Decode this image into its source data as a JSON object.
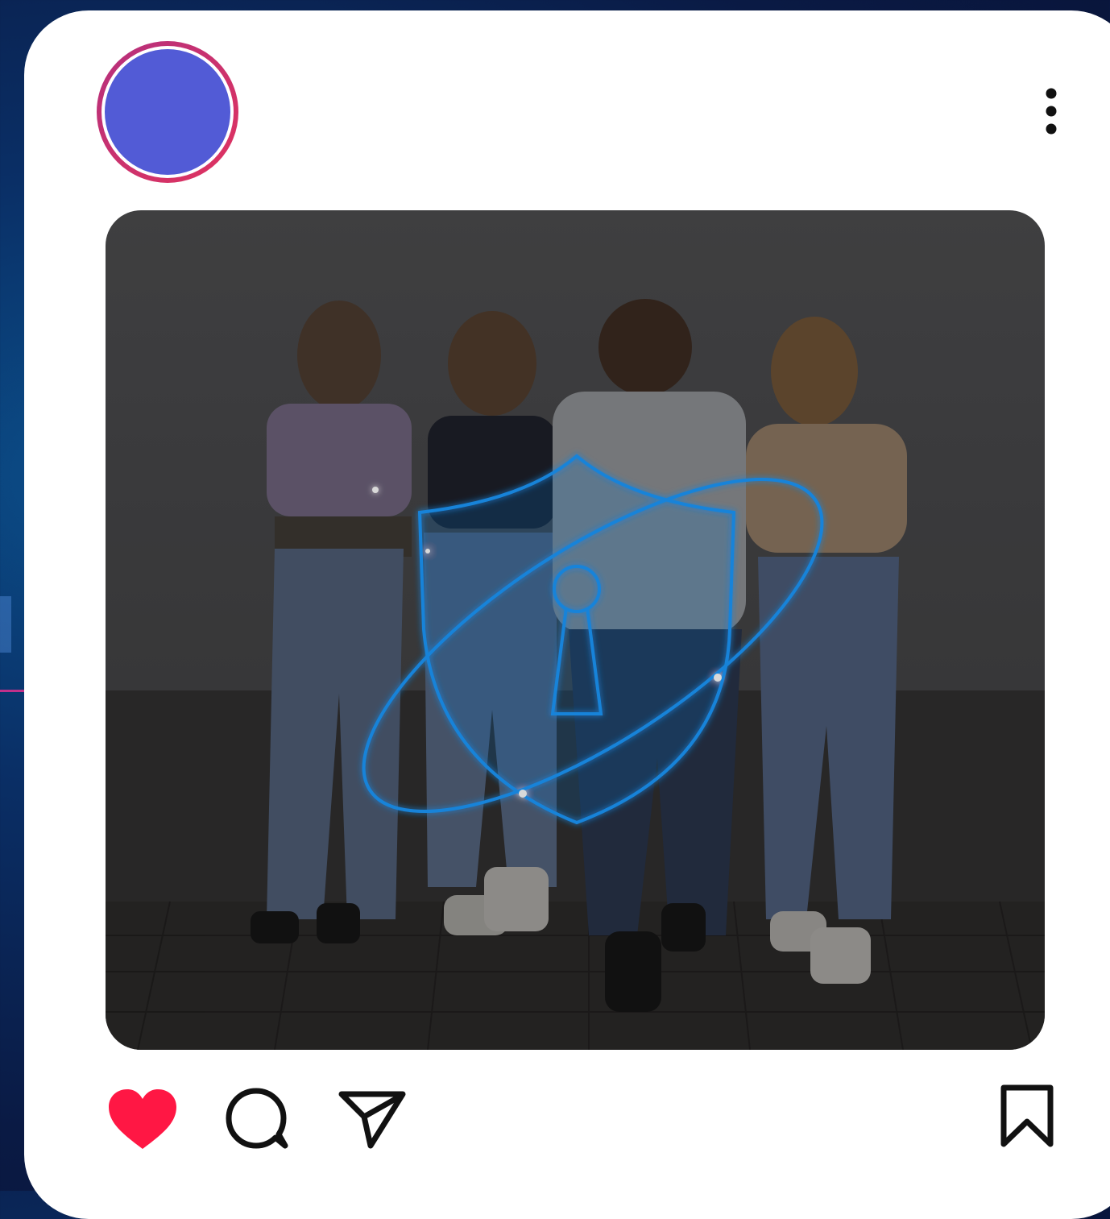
{
  "post": {
    "avatar": {
      "ring_gradient": [
        "#b5307d",
        "#e0335f"
      ],
      "fill_color": "#525bd6"
    },
    "menu_icon": "more-vertical-icon",
    "image": {
      "description_icon": "security-shield-keyhole-icon",
      "accent_color": "#1e9bff"
    },
    "actions": {
      "like_icon": "heart-icon",
      "like_color": "#ff1744",
      "liked": true,
      "comment_icon": "comment-icon",
      "share_icon": "send-icon",
      "save_icon": "bookmark-icon"
    }
  }
}
